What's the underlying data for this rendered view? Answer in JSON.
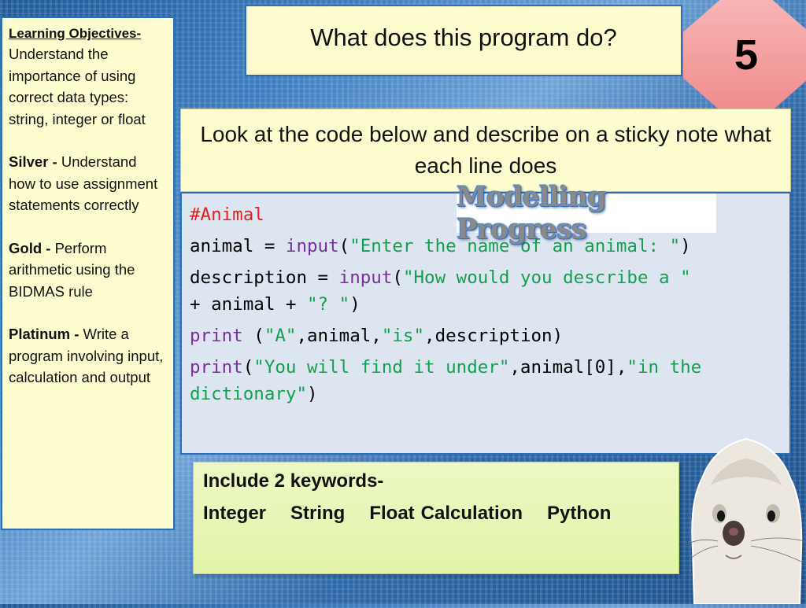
{
  "objectives": {
    "heading": "Learning Objectives-",
    "intro": "Understand the importance of using correct data types: string, integer or float",
    "items": [
      {
        "level": "Silver -",
        "text": " Understand how to use assignment statements correctly"
      },
      {
        "level": "Gold -",
        "text": " Perform arithmetic using the BIDMAS rule"
      },
      {
        "level": "Platinum -",
        "text": " Write a program involving input, calculation and output"
      }
    ]
  },
  "title": "What does this program do?",
  "badge_number": "5",
  "instruction": "Look at the code below and describe on a sticky note what each line does",
  "logo_text": "Modelling Progress",
  "code": {
    "comment": "#Animal",
    "line1": {
      "a": "animal = ",
      "fn": "input",
      "b": "(",
      "str": "\"Enter the name of an animal: \"",
      "c": ")"
    },
    "line2": {
      "a": "description = ",
      "fn": "input",
      "b": "(",
      "str": "\"How would you describe a \"",
      "c": "\n+ animal + ",
      "str2": "\"? \"",
      "d": ")"
    },
    "line3": {
      "fn": "print",
      "a": " (",
      "str": "\"A\"",
      "b": ",animal,",
      "str2": "\"is\"",
      "c": ",description)"
    },
    "line4": {
      "fn": "print",
      "a": "(",
      "str": "\"You will find it under\"",
      "b": ",animal[0],",
      "str2": "\"in the\ndictionary\"",
      "c": ")"
    }
  },
  "keywords": {
    "title": "Include 2 keywords-",
    "list": [
      "Integer",
      "String",
      "Float",
      "Calculation",
      "Python"
    ]
  },
  "colors": {
    "comment": "#e51e1e",
    "function": "#7a2e9e",
    "string": "#12a050",
    "badge": "#f08c8c",
    "note_yellow": "#fefdd0",
    "keywords_green": "#e2f5a8",
    "border_blue": "#2d6fb2"
  }
}
